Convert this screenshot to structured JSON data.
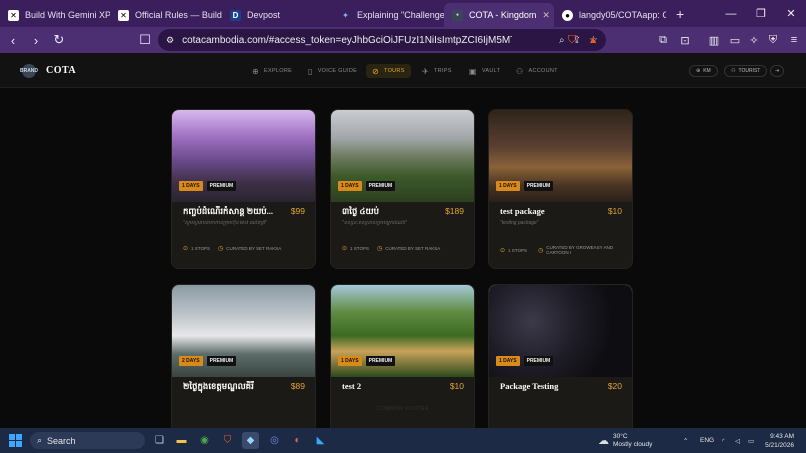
{
  "browser": {
    "tabs": [
      {
        "label": "Build With Gemini XPR",
        "icon": "x-logo-icon",
        "active": false
      },
      {
        "label": "Official Rules — Build",
        "icon": "x-logo-icon",
        "active": false
      },
      {
        "label": "Devpost",
        "icon": "d-logo-icon",
        "active": false
      },
      {
        "label": "Explaining \"Challenge",
        "icon": "gemini-icon",
        "active": false
      },
      {
        "label": "COTA - Kingdom",
        "icon": "cota-icon",
        "active": true
      },
      {
        "label": "langdy05/COTAapp: C",
        "icon": "github-icon",
        "active": false
      }
    ],
    "new_tab": "+",
    "url": "cotacambodia.com/#access_token=eyJhbGciOiJFUzI1NiIsImtpZCI6IjM5MTc2MT...",
    "brave_badge": "2"
  },
  "app": {
    "logo_text": "BRAND",
    "brand": "COTA",
    "nav": [
      {
        "label": "EXPLORE",
        "icon": "globe-icon",
        "active": false
      },
      {
        "label": "VOICE GUIDE",
        "icon": "phone-icon",
        "active": false
      },
      {
        "label": "TOURS",
        "icon": "compass-icon",
        "active": true
      },
      {
        "label": "TRIPS",
        "icon": "plane-icon",
        "active": false
      },
      {
        "label": "VAULT",
        "icon": "vault-icon",
        "active": false
      },
      {
        "label": "ACCOUNT",
        "icon": "user-icon",
        "active": false
      }
    ],
    "lang": "KM",
    "role": "TOURIST",
    "footer": "COMMON FOOTER"
  },
  "tours": [
    {
      "days": "1 DAYS",
      "tier": "PREMIUM",
      "title": "កញ្ចប់ដំណើរកំសាន្ត ២យប់...",
      "price": "$99",
      "desc": "\"សូមស្វាគមន៍មកកាន់ក្រុមហ៊ុន test ណើតត្រី\"",
      "stops": "1 STOPS",
      "curator": "CURATED BY SET RAKSA",
      "image": "purple-mist"
    },
    {
      "days": "1 DAYS",
      "tier": "PREMIUM",
      "title": "៣ថ្ងៃ ៤យប់",
      "price": "$189",
      "desc": "\"ទស្សនៈទស្សនាសម្រាប់អ្នកដំណើរ\"",
      "stops": "1 STOPS",
      "curator": "CURATED BY SET RAKSA",
      "image": "green-valley"
    },
    {
      "days": "1 DAYS",
      "tier": "PREMIUM",
      "title": "test package",
      "price": "$10",
      "desc": "\"testing package\"",
      "stops": "1 STOPS",
      "curator": "CURATED BY GROWEASY AND CARTOON I",
      "image": "desert-dusk"
    },
    {
      "days": "2 DAYS",
      "tier": "PREMIUM",
      "title": "២ថ្ងៃក្នុងខេត្តមណ្ឌលគិរី",
      "price": "$89",
      "desc": "",
      "stops": "",
      "curator": "",
      "image": "airport"
    },
    {
      "days": "1 DAYS",
      "tier": "PREMIUM",
      "title": "test 2",
      "price": "$10",
      "desc": "",
      "stops": "",
      "curator": "",
      "image": "forest-path"
    },
    {
      "days": "1 DAYS",
      "tier": "PREMIUM",
      "title": "Package Testing",
      "price": "$20",
      "desc": "",
      "stops": "",
      "curator": "",
      "image": "grapes"
    }
  ],
  "taskbar": {
    "search": "Search",
    "weather_temp": "30°C",
    "weather_desc": "Mostly cloudy",
    "lang": "ENG",
    "time": "9:43 AM",
    "date": "5/21/2026"
  },
  "colors": {
    "accent": "#e0a62e",
    "browser": "#4c2f72",
    "taskbar": "#1d2a46"
  }
}
